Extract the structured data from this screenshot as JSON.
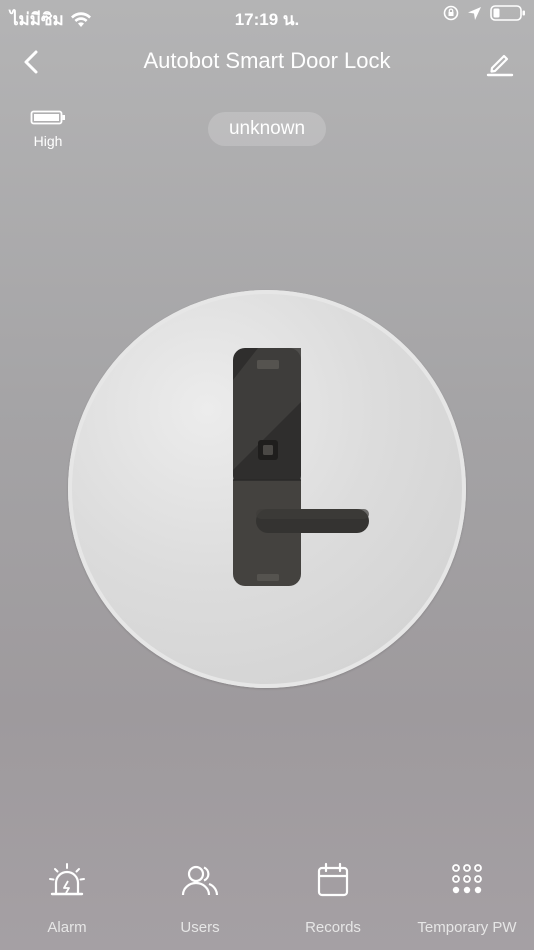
{
  "status_bar": {
    "carrier": "ไม่มีซิม",
    "time": "17:19 น."
  },
  "header": {
    "title": "Autobot Smart Door Lock"
  },
  "battery": {
    "label": "High"
  },
  "lock_status": "unknown",
  "tabs": [
    {
      "label": "Alarm",
      "icon": "alarm-siren-icon"
    },
    {
      "label": "Users",
      "icon": "users-icon"
    },
    {
      "label": "Records",
      "icon": "calendar-icon"
    },
    {
      "label": "Temporary PW",
      "icon": "keypad-icon"
    }
  ],
  "colors": {
    "background_top": "#b4b4b5",
    "background_bottom": "#a5a0a4",
    "dial": "#dcdcdc",
    "lock_body": "#3b3a38"
  }
}
